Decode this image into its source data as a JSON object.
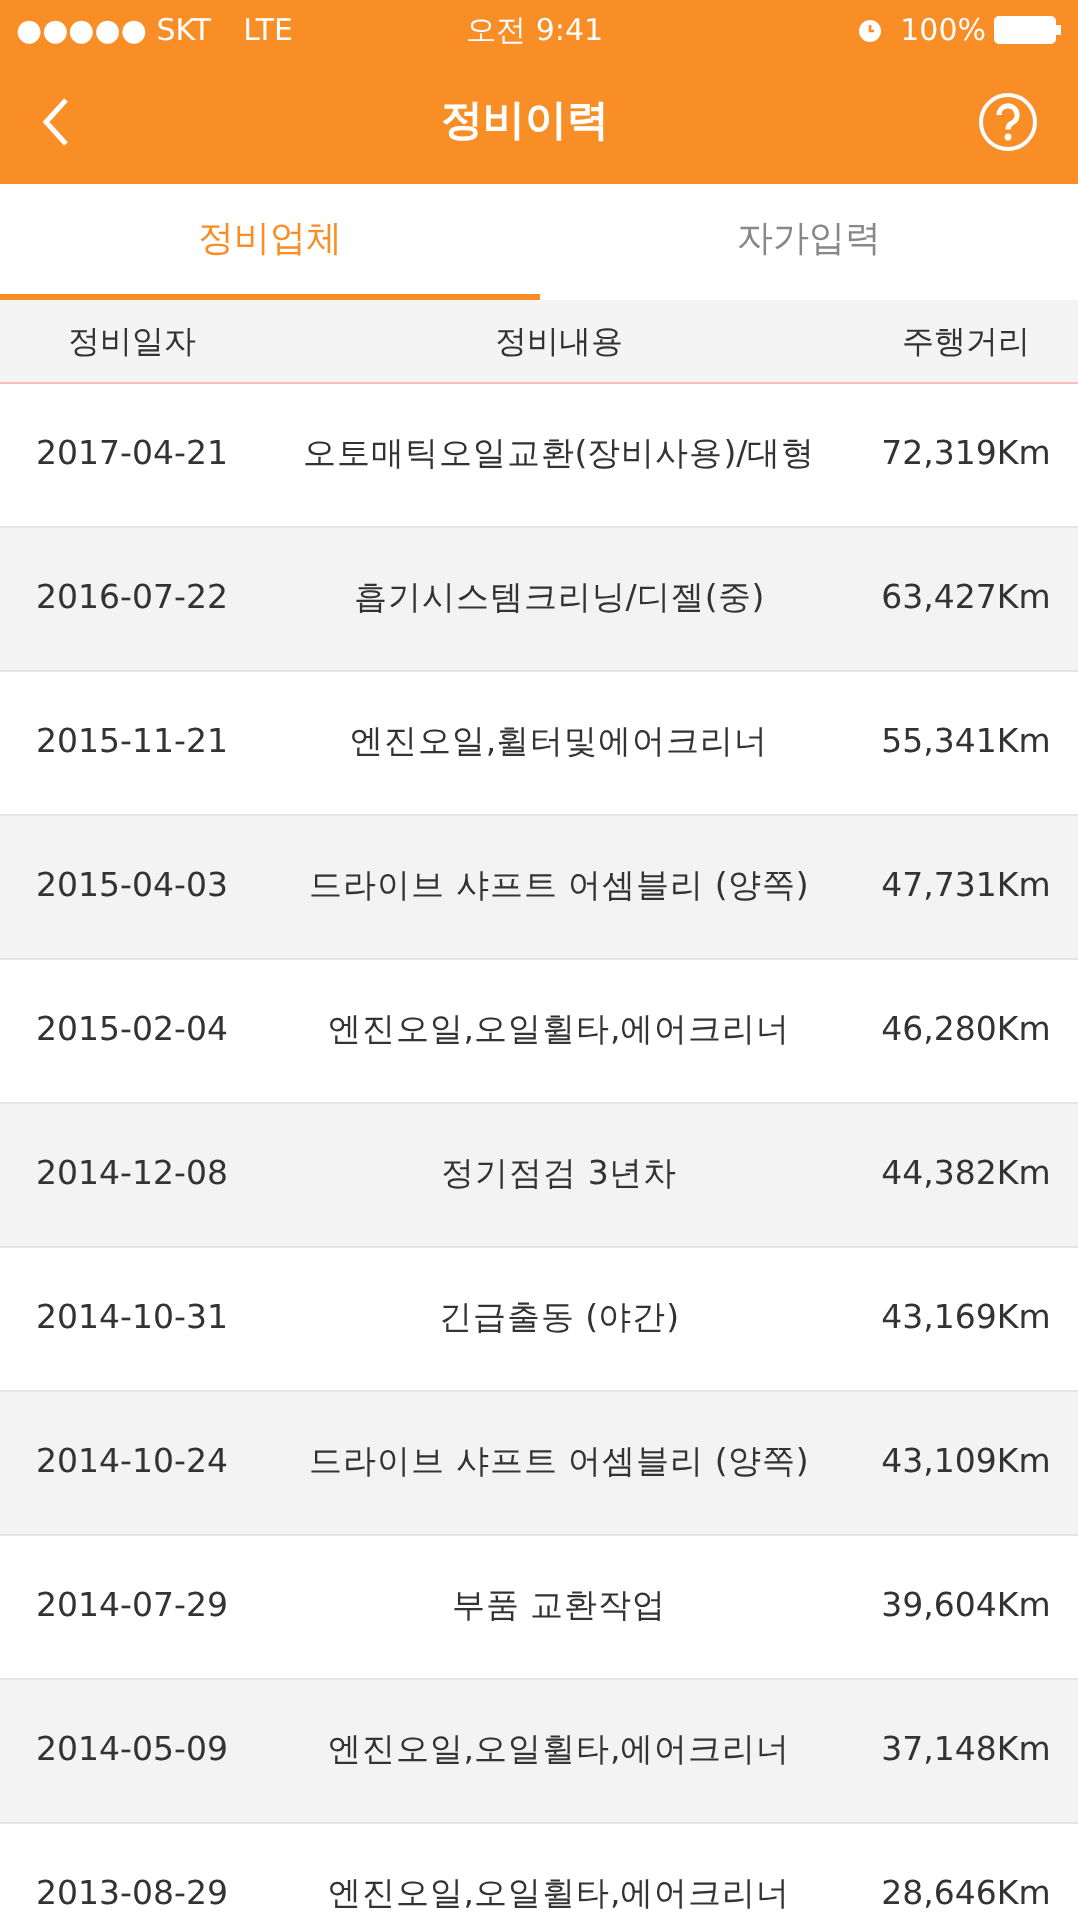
{
  "status_bar": {
    "carrier": "●●●●● SKT",
    "network": "LTE",
    "time": "오전 9:41",
    "battery": "100%"
  },
  "header": {
    "title": "정비이력"
  },
  "tabs": [
    {
      "label": "정비업체",
      "selected": true
    },
    {
      "label": "자가입력",
      "selected": false
    }
  ],
  "table": {
    "columns": [
      "정비일자",
      "정비내용",
      "주행거리"
    ],
    "rows": [
      [
        "2017-04-21",
        "오토매틱오일교환(장비사용)/대형",
        "72,319Km"
      ],
      [
        "2016-07-22",
        "흡기시스템크리닝/디젤(중)",
        "63,427Km"
      ],
      [
        "2015-11-21",
        "엔진오일,휠터및에어크리너",
        "55,341Km"
      ],
      [
        "2015-04-03",
        "드라이브 샤프트 어셈블리 (양쪽)",
        "47,731Km"
      ],
      [
        "2015-02-04",
        "엔진오일,오일휠타,에어크리너",
        "46,280Km"
      ],
      [
        "2014-12-08",
        "정기점검 3년차",
        "44,382Km"
      ],
      [
        "2014-10-31",
        "긴급출동 (야간)",
        "43,169Km"
      ],
      [
        "2014-10-24",
        "드라이브 샤프트 어셈블리 (양쪽)",
        "43,109Km"
      ],
      [
        "2014-07-29",
        "부품 교환작업",
        "39,604Km"
      ],
      [
        "2014-05-09",
        "엔진오일,오일휠타,에어크리너",
        "37,148Km"
      ],
      [
        "2013-08-29",
        "엔진오일,오일휠타,에어크리너",
        "28,646Km"
      ]
    ]
  }
}
